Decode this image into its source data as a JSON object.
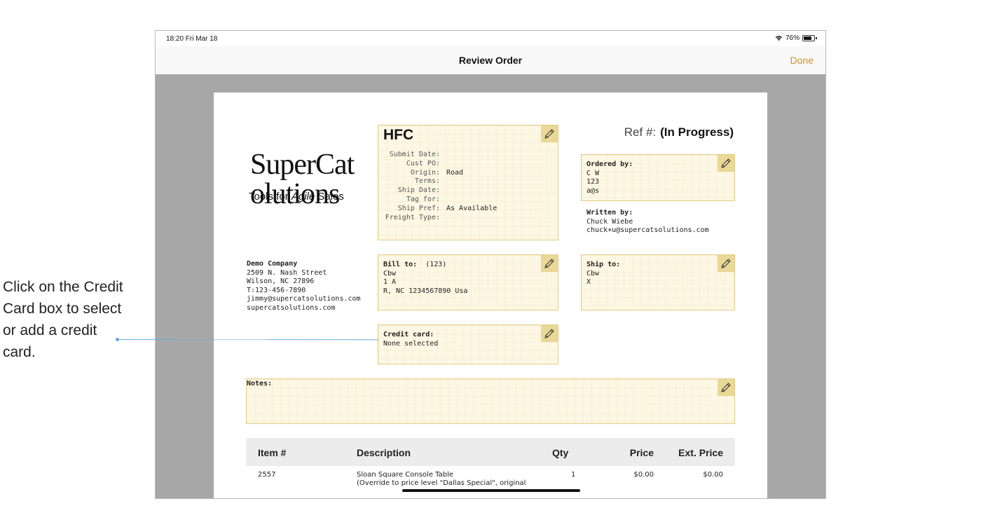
{
  "callout": {
    "text": "Click on the Credit Card box to select or add a credit card."
  },
  "status_bar": {
    "time": "18:20  Fri Mar 18",
    "battery": "76%"
  },
  "navbar": {
    "title": "Review Order",
    "done_label": "Done"
  },
  "order": {
    "logo": {
      "line1": "SuperCat",
      "line2": "olutions",
      "tagline_plain": "Tools for ",
      "tagline_italic": "Agile",
      "tagline_end": " Sales"
    },
    "hfc": {
      "title": "HFC",
      "fields": [
        {
          "label": "Submit Date:",
          "value": ""
        },
        {
          "label": "Cust PO:",
          "value": ""
        },
        {
          "label": "Origin:",
          "value": "Road"
        },
        {
          "label": "Terms:",
          "value": ""
        },
        {
          "label": "Ship Date:",
          "value": ""
        },
        {
          "label": "Tag for:",
          "value": ""
        },
        {
          "label": "Ship Pref:",
          "value": "As Available"
        },
        {
          "label": "Freight Type:",
          "value": ""
        }
      ]
    },
    "ref": {
      "label": "Ref #:",
      "value": "(In Progress)"
    },
    "ordered_by": {
      "label": "Ordered by:",
      "name": "C W",
      "number": "123",
      "email": "a@s"
    },
    "written_by": {
      "label": "Written by:",
      "name": "Chuck Wiebe",
      "email": "chuck+u@supercatsolutions.com"
    },
    "company": {
      "name": "Demo Company",
      "street": "2509 N. Nash Street",
      "city": "Wilson, NC 27896",
      "phone": "T:123-456-7890",
      "email": "jimmy@supercatsolutions.com",
      "web": "supercatsolutions.com"
    },
    "bill_to": {
      "label": "Bill to:",
      "code": "(123)",
      "line1": "Cbw",
      "line2": "1 A",
      "line3": "R, NC 1234567890 Usa"
    },
    "ship_to": {
      "label": "Ship to:",
      "line1": "Cbw",
      "line2": "X"
    },
    "credit_card": {
      "label": "Credit card:",
      "value": "None selected"
    },
    "notes": {
      "label": "Notes:"
    },
    "items": {
      "columns": {
        "item": "Item #",
        "description": "Description",
        "qty": "Qty",
        "price": "Price",
        "ext_price": "Ext. Price"
      },
      "rows": [
        {
          "item": "2557",
          "description": "Sloan Square Console Table",
          "description2": "(Override to price level \"Dallas Special\", original",
          "qty": "1",
          "price": "$0.00",
          "ext_price": "$0.00"
        }
      ]
    }
  },
  "colors": {
    "accent": "#c9962a",
    "box_fill": "#fdf8e4",
    "box_border": "#e3cc85",
    "callout_line": "#6aaad8"
  },
  "icons": {
    "pencil": "pencil-icon",
    "wifi": "wifi-icon",
    "battery": "battery-icon"
  }
}
